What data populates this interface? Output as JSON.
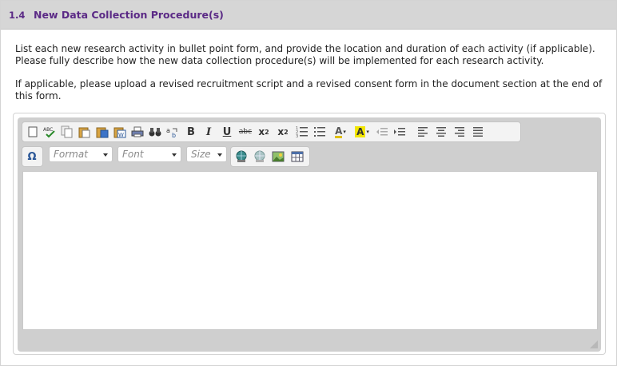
{
  "section": {
    "number": "1.4",
    "title": "New Data Collection Procedure(s)"
  },
  "instructions": {
    "paragraph1": "List each new research activity in bullet point form, and provide the location and duration of each activity (if applicable). Please fully describe how the new data collection procedure(s) will be implemented for each research activity.",
    "paragraph2": "If applicable, please upload a revised recruitment script and a revised consent form in the document section at the end of this form."
  },
  "toolbar": {
    "spellcheck_label": "ABC",
    "bold_label": "B",
    "italic_label": "I",
    "underline_label": "U",
    "strike_label": "abc",
    "subscript_label": "x",
    "subscript_sub": "2",
    "superscript_label": "x",
    "superscript_sup": "2",
    "font_color_label": "A",
    "bg_color_label": "A",
    "special_char_label": "Ω",
    "format_label": "Format",
    "font_label": "Font",
    "size_label": "Size"
  },
  "editor": {
    "content": ""
  },
  "colors": {
    "header_bg": "#d6d6d6",
    "title_color": "#5b2a86",
    "toolbar_bg": "#cfcfcf"
  }
}
